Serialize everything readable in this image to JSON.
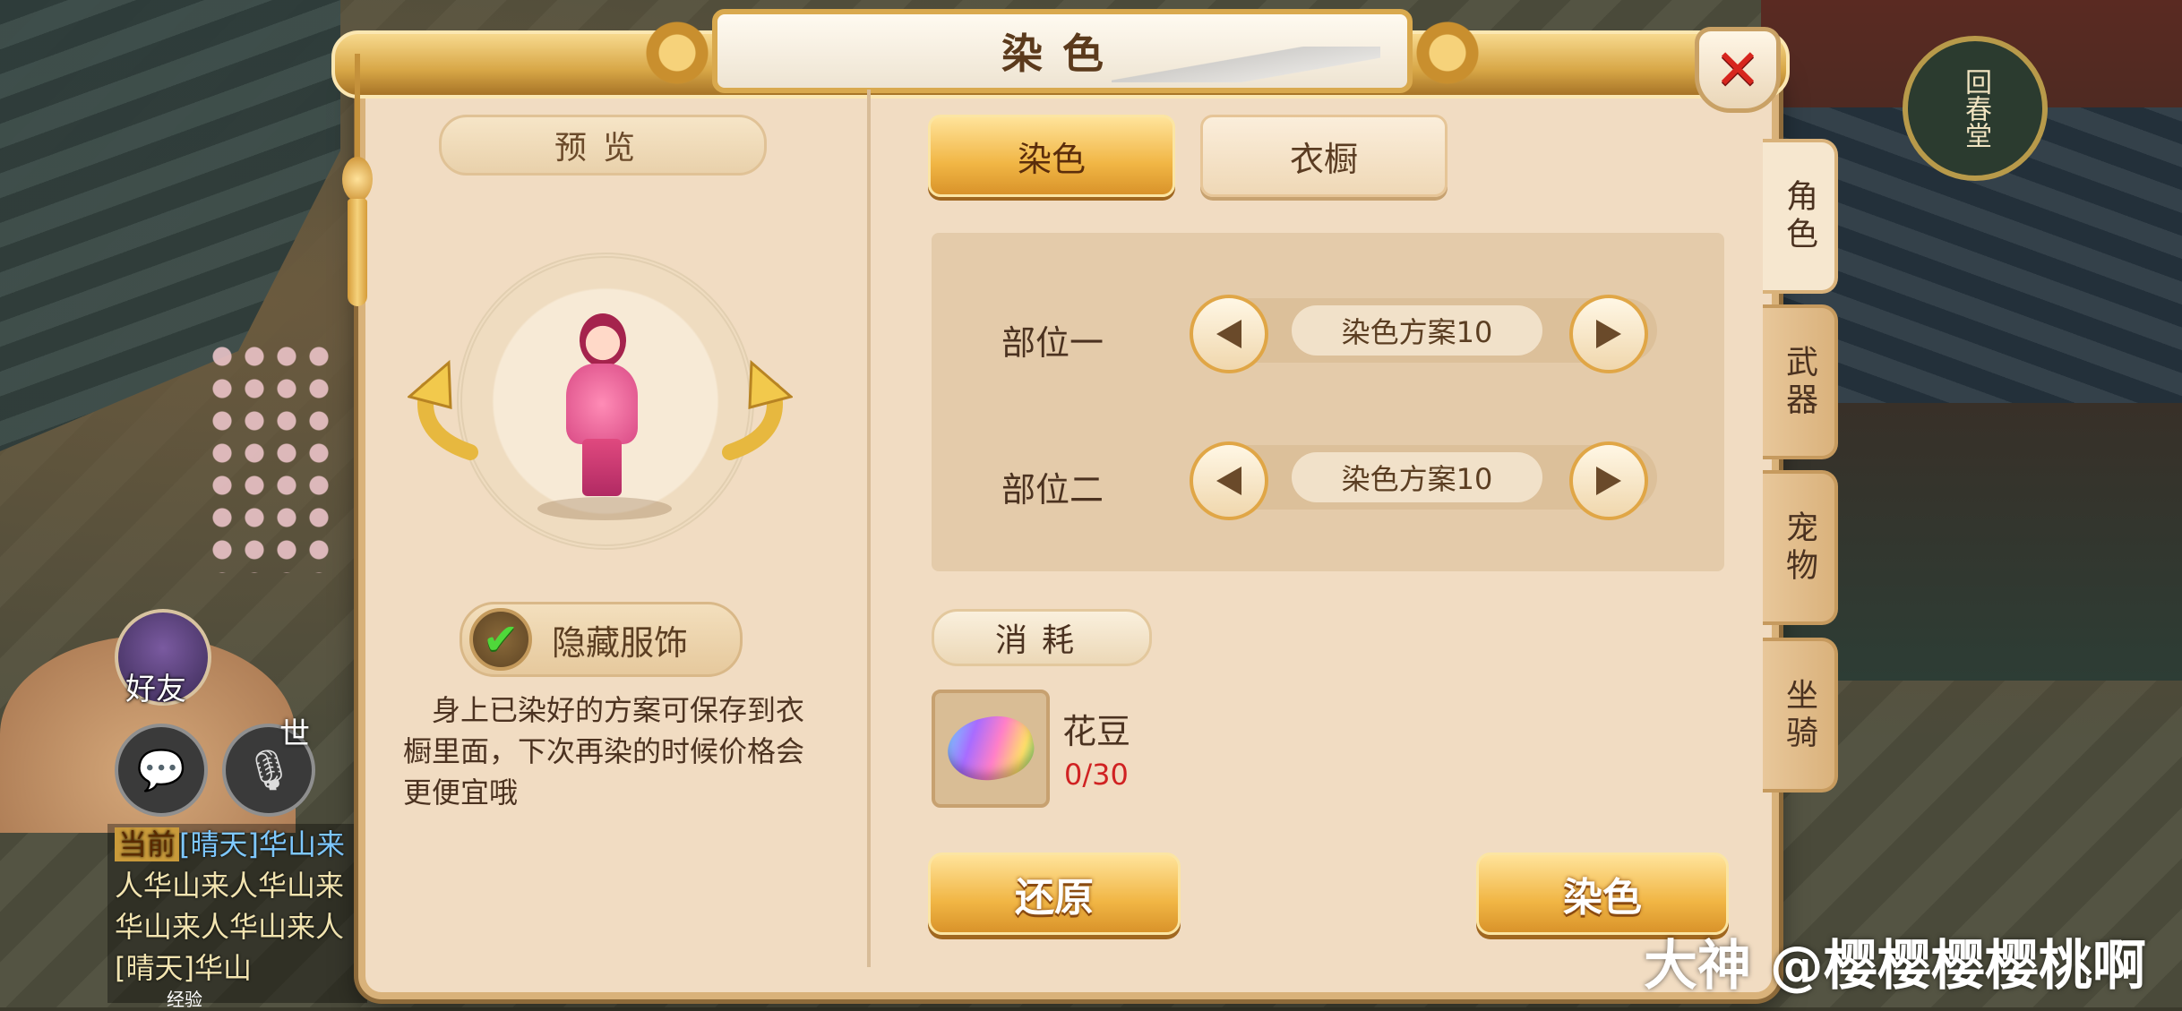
{
  "window": {
    "title": "染色"
  },
  "preview": {
    "header": "预览",
    "hide_costume_label": "隐藏服饰",
    "hide_costume_checked": true,
    "tip": "身上已染好的方案可保存到衣橱里面，下次再染的时候价格会更便宜哦"
  },
  "tabs": [
    {
      "label": "染色",
      "active": true
    },
    {
      "label": "衣橱",
      "active": false
    }
  ],
  "slots": [
    {
      "label": "部位一",
      "value": "染色方案10"
    },
    {
      "label": "部位二",
      "value": "染色方案10"
    }
  ],
  "cost": {
    "header": "消耗",
    "item_name": "花豆",
    "item_count": "0/30"
  },
  "actions": {
    "restore": "还原",
    "apply": "染色"
  },
  "side_tabs": [
    {
      "label": "角色",
      "active": true
    },
    {
      "label": "武器",
      "active": false
    },
    {
      "label": "宠物",
      "active": false
    },
    {
      "label": "坐骑",
      "active": false
    }
  ],
  "hud": {
    "friend_label": "好友",
    "world_label": "世",
    "chat_lines": [
      {
        "tag": "当前",
        "text": "[晴天]华山来"
      },
      {
        "tag": "",
        "text": "人华山来人华山来"
      },
      {
        "tag": "",
        "text": "华山来人华山来人"
      },
      {
        "tag": "",
        "text": "[晴天]华山"
      }
    ],
    "exp_label": "经验"
  },
  "background": {
    "plaque_text": "回春堂"
  },
  "watermark": "大神 @樱樱樱樱桃啊",
  "colors": {
    "accent_gold": "#f1b645",
    "panel_bg": "#f1dcc2",
    "count_red": "#d02222",
    "close_red": "#d7261e"
  }
}
